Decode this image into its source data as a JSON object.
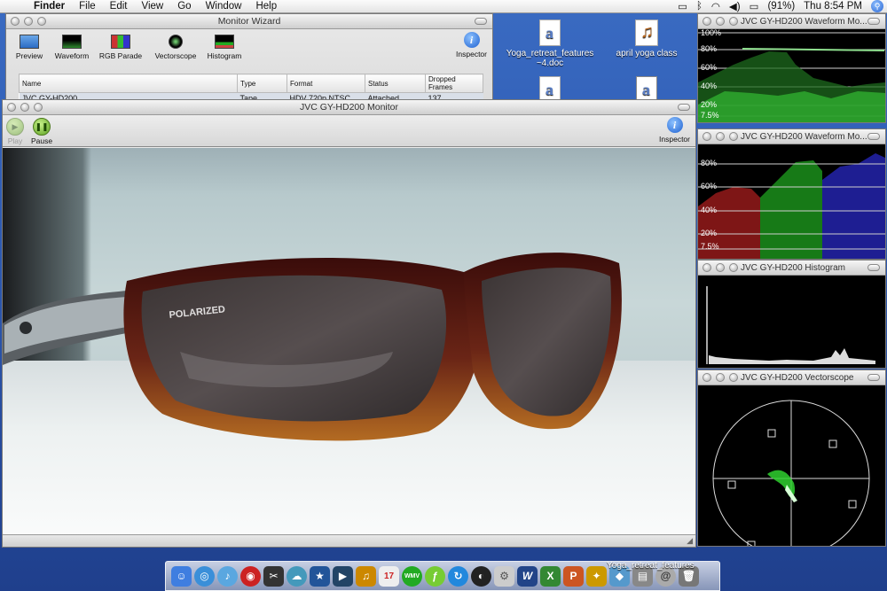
{
  "menubar": {
    "app": "Finder",
    "menus": [
      "File",
      "Edit",
      "View",
      "Go",
      "Window",
      "Help"
    ],
    "battery": "(91%)",
    "clock": "Thu 8:54 PM"
  },
  "desktop_icons": [
    {
      "label": "Yoga_retreat_features\n~4.doc"
    },
    {
      "label": "april yoga class"
    }
  ],
  "wizard": {
    "title": "Monitor Wizard",
    "tools": [
      "Preview",
      "Waveform",
      "RGB Parade",
      "Vectorscope",
      "Histogram"
    ],
    "inspector": "Inspector",
    "columns": [
      "Name",
      "Type",
      "Format",
      "Status",
      "Dropped Frames"
    ],
    "rows": [
      [
        "JVC GY-HD200",
        "Tape",
        "HDV 720p NTSC",
        "Attached",
        "137"
      ]
    ]
  },
  "monitor": {
    "title": "JVC GY-HD200 Monitor",
    "play": "Play",
    "pause": "Pause",
    "inspector": "Inspector",
    "lens_brand": "POLARIZED"
  },
  "scopes": {
    "waveform1_title": "JVC GY-HD200 Waveform Mo...",
    "waveform2_title": "JVC GY-HD200 Waveform Mo...",
    "histogram_title": "JVC GY-HD200 Histogram",
    "vectorscope_title": "JVC GY-HD200 Vectorscope",
    "wave_labels": [
      "100%",
      "80%",
      "60%",
      "40%",
      "20%",
      "7.5%"
    ],
    "wave2_labels": [
      "80%",
      "60%",
      "40%",
      "20%",
      "7.5%"
    ]
  },
  "dock": {
    "hover_label": "Yoga_retreat_features"
  }
}
